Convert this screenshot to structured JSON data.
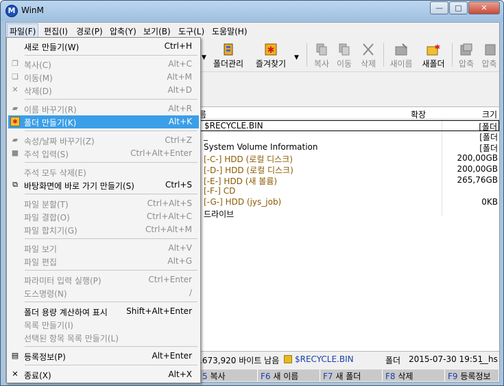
{
  "window": {
    "title": "WinM",
    "app_icon_glyph": "M"
  },
  "window_controls": {
    "minimize": "—",
    "maximize": "□",
    "close": "✕"
  },
  "menubar": [
    "파일(F)",
    "편집(I)",
    "경로(P)",
    "압축(Y)",
    "보기(B)",
    "도구(L)",
    "도움말(H)"
  ],
  "toolbar": {
    "folder_manage": "폴더관리",
    "favorites": "즐겨찾기",
    "dropdown_arrow": "▼",
    "copy": "복사",
    "move": "이동",
    "delete": "삭제",
    "rename": "새이름",
    "new_folder": "새폴더",
    "compress": "압축",
    "compress2": "압축"
  },
  "file_list": {
    "col_name": "름",
    "col_ext": "확장",
    "col_size": "크기",
    "rows": [
      {
        "name": "$RECYCLE.BIN",
        "size": "[폴더"
      },
      {
        "name": "_",
        "size": "[폴더"
      },
      {
        "name": "System Volume Information",
        "size": "[폴더"
      },
      {
        "name": "[-C-] HDD (로컬 디스크)",
        "size": "200,00GB"
      },
      {
        "name": "[-D-] HDD (로컬 디스크)",
        "size": "200,00GB"
      },
      {
        "name": "[-E-] HDD (새 볼륨)",
        "size": "265,76GB"
      },
      {
        "name": "[-F-] CD",
        "size": ""
      },
      {
        "name": "[-G-] HDD (jys_job)",
        "size": "0KB"
      },
      {
        "name": "드라이브",
        "size": ""
      }
    ]
  },
  "status": {
    "free": ",673,920 바이트 남음",
    "selected": "$RECYCLE.BIN",
    "type": "폴더",
    "date": "2015-07-30 19:51",
    "attr": "__hs"
  },
  "fkeys": [
    {
      "key": "5",
      "label": "복사"
    },
    {
      "key": "F6",
      "label": "새 이름"
    },
    {
      "key": "F7",
      "label": "새 폴더"
    },
    {
      "key": "F8",
      "label": "삭제"
    },
    {
      "key": "F9",
      "label": "등록정보"
    }
  ],
  "file_menu": {
    "items": [
      {
        "label": "새로 만들기(W)",
        "shortcut": "Ctrl+H",
        "icon": "",
        "disabled": false
      },
      {
        "label": "복사(C)",
        "shortcut": "Alt+C",
        "icon": "copy-icon",
        "disabled": true
      },
      {
        "label": "이동(M)",
        "shortcut": "Alt+M",
        "icon": "move-icon",
        "disabled": true
      },
      {
        "label": "삭제(D)",
        "shortcut": "Alt+D",
        "icon": "delete-icon",
        "disabled": true
      },
      {
        "label": "이름 바꾸기(R)",
        "shortcut": "Alt+R",
        "icon": "rename-icon",
        "disabled": true
      },
      {
        "label": "폴더 만들기(K)",
        "shortcut": "Alt+K",
        "icon": "new-folder-icon",
        "disabled": false,
        "highlighted": true
      },
      {
        "label": "속성/날짜 바꾸기(Z)",
        "shortcut": "Ctrl+Z",
        "icon": "attributes-icon",
        "disabled": true
      },
      {
        "label": "주석 입력(S)",
        "shortcut": "Ctrl+Alt+Enter",
        "icon": "comment-icon",
        "disabled": true
      },
      {
        "label": "주석 모두 삭제(E)",
        "shortcut": "",
        "icon": "",
        "disabled": true
      },
      {
        "label": "바탕화면에 바로 가기 만들기(S)",
        "shortcut": "Ctrl+S",
        "icon": "shortcut-icon",
        "disabled": false
      },
      {
        "label": "파일 분할(T)",
        "shortcut": "Ctrl+Alt+S",
        "icon": "",
        "disabled": true
      },
      {
        "label": "파일 결합(O)",
        "shortcut": "Ctrl+Alt+C",
        "icon": "",
        "disabled": true
      },
      {
        "label": "파일 합치기(G)",
        "shortcut": "Ctrl+Alt+M",
        "icon": "",
        "disabled": true
      },
      {
        "label": "파일 보기",
        "shortcut": "Alt+V",
        "icon": "",
        "disabled": true
      },
      {
        "label": "파일 편집",
        "shortcut": "Alt+G",
        "icon": "",
        "disabled": true
      },
      {
        "label": "파라미터 입력 실행(P)",
        "shortcut": "Ctrl+Enter",
        "icon": "",
        "disabled": true
      },
      {
        "label": "도스명령(N)",
        "shortcut": "/",
        "icon": "",
        "disabled": true
      },
      {
        "label": "폴더 용량 계산하여 표시",
        "shortcut": "Shift+Alt+Enter",
        "icon": "",
        "disabled": false
      },
      {
        "label": "목록 만들기(I)",
        "shortcut": "",
        "icon": "",
        "disabled": true
      },
      {
        "label": "선택된 항목 목록 만들기(L)",
        "shortcut": "",
        "icon": "",
        "disabled": true
      },
      {
        "label": "등록정보(P)",
        "shortcut": "Alt+Enter",
        "icon": "properties-icon",
        "disabled": false
      },
      {
        "label": "종료(X)",
        "shortcut": "Alt+X",
        "icon": "exit-icon",
        "disabled": false
      }
    ]
  },
  "colors": {
    "highlight": "#3b9ee8",
    "disabled_text": "#8d8d8d",
    "drive_text": "#8a5a00"
  }
}
